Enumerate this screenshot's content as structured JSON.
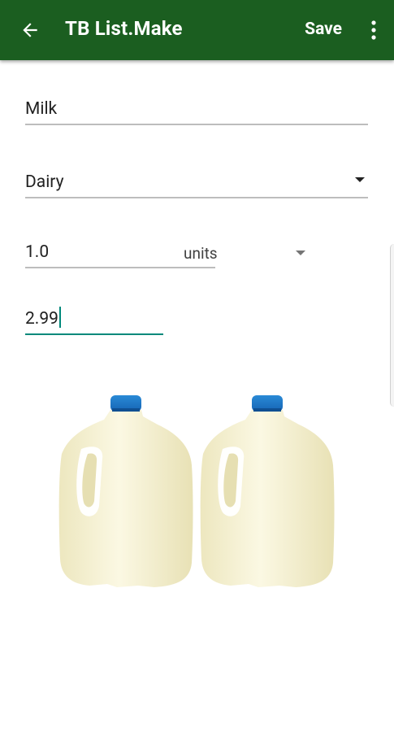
{
  "appbar": {
    "title": "TB List.Make",
    "save_label": "Save",
    "background_color": "#1b5e20",
    "back_icon": "arrow-left-icon",
    "overflow_icon": "more-vert-icon"
  },
  "form": {
    "name_value": "Milk",
    "category_value": "Dairy",
    "quantity_value": "1.0",
    "unit_value": "units",
    "price_value": "2.99",
    "accent_color": "#00897b"
  },
  "image": {
    "subject": "milk-jugs-image"
  }
}
